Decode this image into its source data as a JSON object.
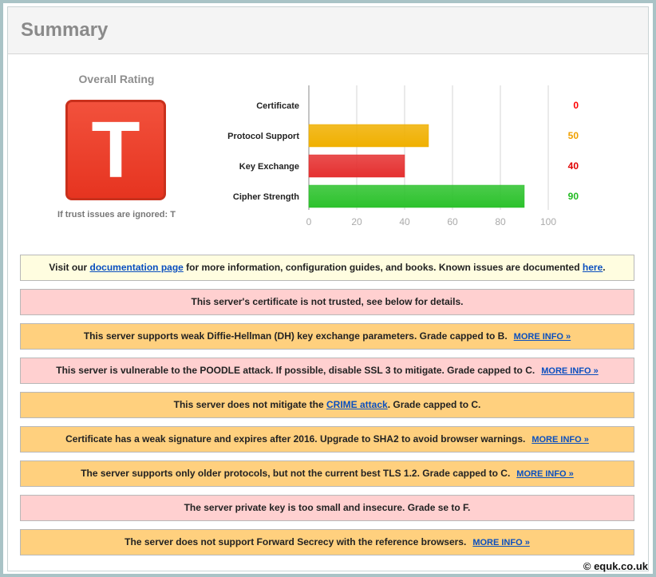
{
  "summary": {
    "title": "Summary"
  },
  "rating": {
    "title": "Overall Rating",
    "grade": "T",
    "grade_color": "#e8412b",
    "note": "If trust issues are ignored: T"
  },
  "chart_data": {
    "type": "bar",
    "orientation": "horizontal",
    "categories": [
      "Certificate",
      "Protocol Support",
      "Key Exchange",
      "Cipher Strength"
    ],
    "values": [
      0,
      50,
      40,
      90
    ],
    "value_labels": [
      "0",
      "50",
      "40",
      "90"
    ],
    "colors": [
      "#ff0000",
      "#f0b000",
      "#e53030",
      "#2cc22c"
    ],
    "value_colors": [
      "#ff0000",
      "#f0a000",
      "#e00000",
      "#22bb22"
    ],
    "xlim": [
      0,
      100
    ],
    "xticks": [
      "0",
      "20",
      "40",
      "60",
      "80",
      "100"
    ],
    "grid": true
  },
  "messages": [
    {
      "style": "yellow",
      "pre": "Visit our ",
      "link1": "documentation page",
      "mid": " for more information, configuration guides, and books. Known issues are documented ",
      "link2": "here",
      "post": "."
    },
    {
      "style": "red",
      "text": "This server's certificate is not trusted, see below for details."
    },
    {
      "style": "orange",
      "text": "This server supports weak Diffie-Hellman (DH) key exchange parameters. Grade capped to B.",
      "more": "MORE INFO »"
    },
    {
      "style": "red",
      "text": "This server is vulnerable to the POODLE attack. If possible, disable SSL 3 to mitigate. Grade capped to C.",
      "more": "MORE INFO »"
    },
    {
      "style": "orange",
      "pre": "This server does not mitigate the ",
      "link1": "CRIME attack",
      "post": ". Grade capped to C."
    },
    {
      "style": "orange",
      "text": "Certificate has a weak signature and expires after 2016. Upgrade to SHA2 to avoid browser warnings.",
      "more": "MORE INFO »"
    },
    {
      "style": "orange",
      "text": "The server supports only older protocols, but not the current best TLS 1.2. Grade capped to C.",
      "more": "MORE INFO »"
    },
    {
      "style": "red",
      "text": "The server private key is too small and insecure. Grade se to F."
    },
    {
      "style": "orange",
      "text": "The server does not support Forward Secrecy with the reference browsers.",
      "more": "MORE INFO »"
    }
  ],
  "copyright": "© equk.co.uk"
}
